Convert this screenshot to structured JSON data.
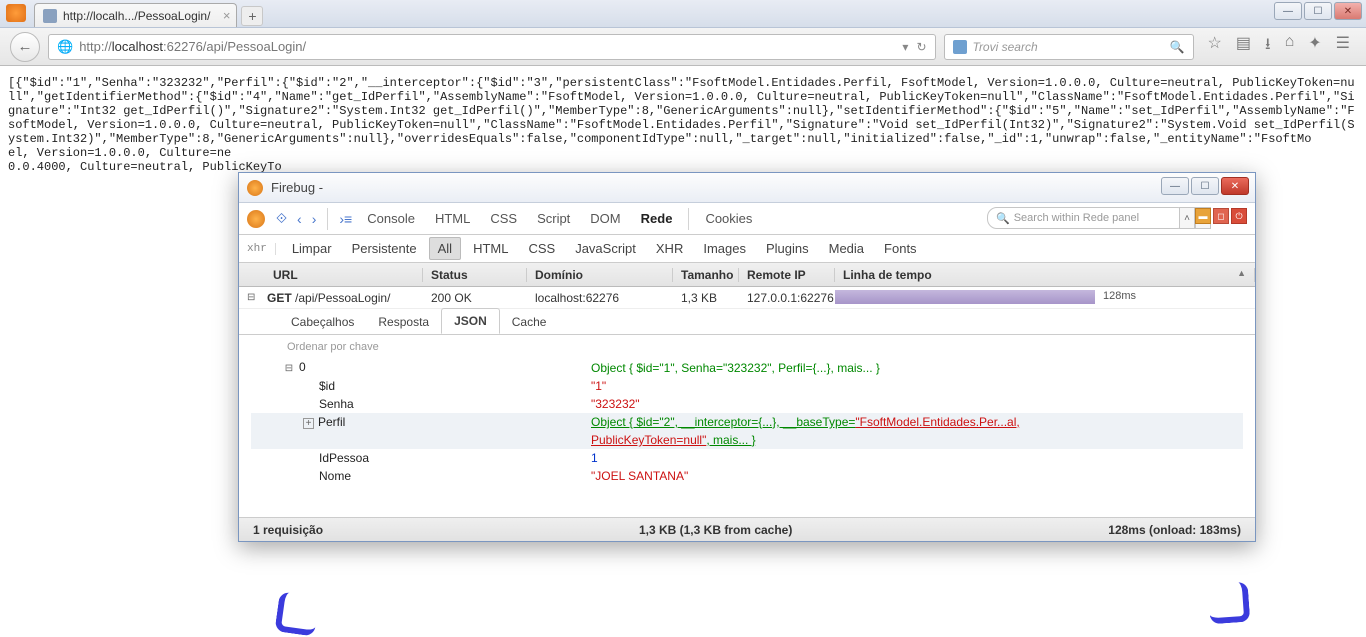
{
  "browser": {
    "tab_title": "http://localh.../PessoaLogin/",
    "url_prefix": "http://",
    "url_host": "localhost",
    "url_path": ":62276/api/PessoaLogin/",
    "search_placeholder": "Trovi search",
    "dropdown_glyph": "▾",
    "reload_glyph": "↻"
  },
  "page_body": "[{\"$id\":\"1\",\"Senha\":\"323232\",\"Perfil\":{\"$id\":\"2\",\"__interceptor\":{\"$id\":\"3\",\"persistentClass\":\"FsoftModel.Entidades.Perfil, FsoftModel, Version=1.0.0.0, Culture=neutral, PublicKeyToken=null\",\"getIdentifierMethod\":{\"$id\":\"4\",\"Name\":\"get_IdPerfil\",\"AssemblyName\":\"FsoftModel, Version=1.0.0.0, Culture=neutral, PublicKeyToken=null\",\"ClassName\":\"FsoftModel.Entidades.Perfil\",\"Signature\":\"Int32 get_IdPerfil()\",\"Signature2\":\"System.Int32 get_IdPerfil()\",\"MemberType\":8,\"GenericArguments\":null},\"setIdentifierMethod\":{\"$id\":\"5\",\"Name\":\"set_IdPerfil\",\"AssemblyName\":\"FsoftModel, Version=1.0.0.0, Culture=neutral, PublicKeyToken=null\",\"ClassName\":\"FsoftModel.Entidades.Perfil\",\"Signature\":\"Void set_IdPerfil(Int32)\",\"Signature2\":\"System.Void set_IdPerfil(System.Int32)\",\"MemberType\":8,\"GenericArguments\":null},\"overridesEquals\":false,\"componentIdType\":null,\"_target\":null,\"initialized\":false,\"_id\":1,\"unwrap\":false,\"_entityName\":\"FsoftMo                                                                                                                                        el, Version=1.0.0.0, Culture=ne                                                                                                                                                              0.0.4000, Culture=neutral, PublicKeyTo",
  "firebug": {
    "title": "Firebug -",
    "tabs": [
      "Console",
      "HTML",
      "CSS",
      "Script",
      "DOM",
      "Rede",
      "Cookies"
    ],
    "active_tab": "Rede",
    "search_placeholder": "Search within Rede panel",
    "subtabs": {
      "xhr_label": "xhr",
      "items": [
        "Limpar",
        "Persistente",
        "All",
        "HTML",
        "CSS",
        "JavaScript",
        "XHR",
        "Images",
        "Plugins",
        "Media",
        "Fonts"
      ],
      "active": "All"
    },
    "columns": {
      "url": "URL",
      "status": "Status",
      "dominio": "Domínio",
      "tamanho": "Tamanho",
      "remote": "Remote IP",
      "linha": "Linha de tempo"
    },
    "request": {
      "toggle": "⊟",
      "method": "GET",
      "path": "/api/PessoaLogin/",
      "status": "200 OK",
      "domain": "localhost:62276",
      "size": "1,3 KB",
      "ip": "127.0.0.1:62276",
      "time": "128ms"
    },
    "inner_tabs": [
      "Cabeçalhos",
      "Resposta",
      "JSON",
      "Cache"
    ],
    "inner_active": "JSON",
    "sort_hint": "Ordenar por chave",
    "tree": {
      "root_key": "0",
      "root_toggle": "⊟",
      "root_val": "Object { $id=\"1\",  Senha=\"323232\",  Perfil={...},  mais... }",
      "id_key": "$id",
      "id_val": "\"1\"",
      "senha_key": "Senha",
      "senha_val": "\"323232\"",
      "perfil_key": "Perfil",
      "perfil_toggle": "+",
      "perfil_val_a": "Object { $id=\"2\",  __interceptor={...},  __baseType=",
      "perfil_val_b": "\"FsoftModel.Entidades.Per...al, ",
      "perfil_val_c": "PublicKeyToken=null\"",
      "perfil_val_d": ",  mais... }",
      "idpessoa_key": "IdPessoa",
      "idpessoa_val": "1",
      "nome_key": "Nome",
      "nome_val": "\"JOEL SANTANA\""
    },
    "status_bar": {
      "left": "1 requisição",
      "mid": "1,3 KB   (1,3 KB from cache)",
      "right": "128ms (onload: 183ms)"
    }
  }
}
